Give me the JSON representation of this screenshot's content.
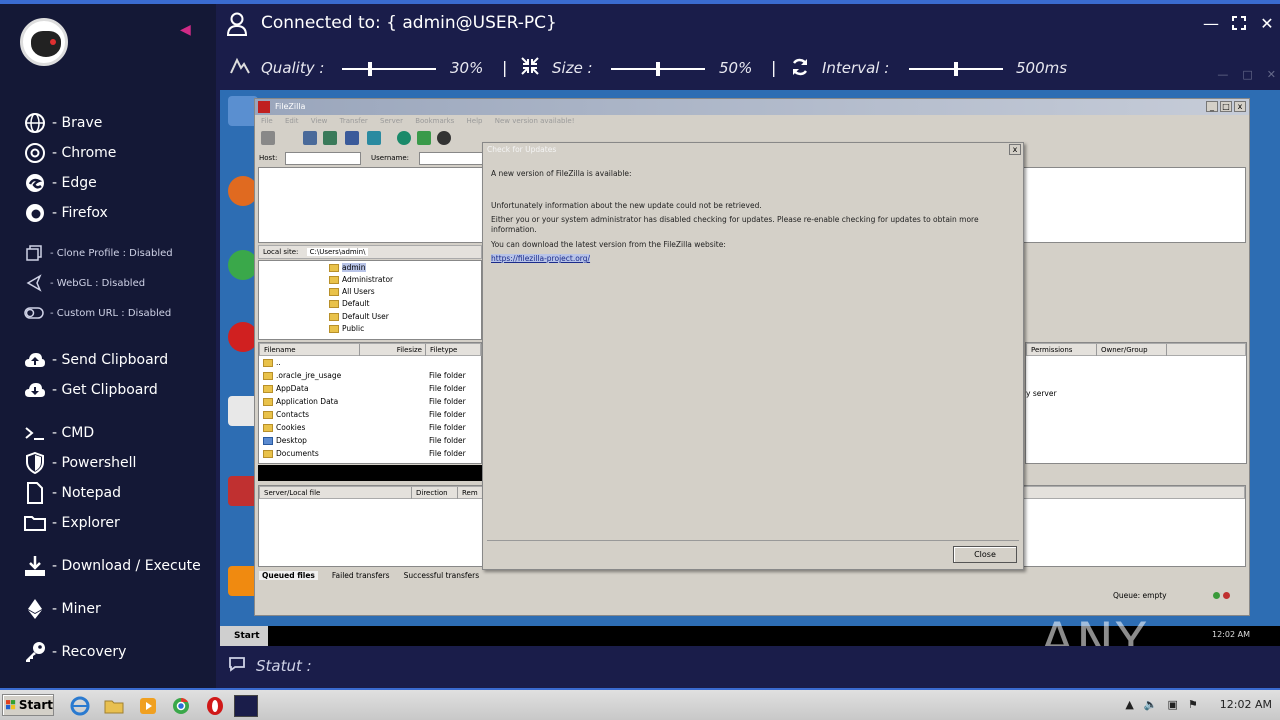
{
  "header": {
    "title": "Connected to: { admin@USER-PC}",
    "quality_label": "Quality :",
    "quality_value": "30%",
    "quality_level": 0.3,
    "size_label": "Size :",
    "size_value": "50%",
    "size_level": 0.5,
    "interval_label": "Interval :",
    "interval_value": "500ms",
    "interval_level": 0.5,
    "separator": "|"
  },
  "sidebar": {
    "browsers": [
      {
        "label": "- Brave",
        "icon": "globe-icon"
      },
      {
        "label": "- Chrome",
        "icon": "chrome-icon"
      },
      {
        "label": "- Edge",
        "icon": "edge-icon"
      },
      {
        "label": "- Firefox",
        "icon": "firefox-icon"
      }
    ],
    "settings": [
      {
        "label": "- Clone Profile : Disabled",
        "icon": "copy-icon"
      },
      {
        "label": "- WebGL : Disabled",
        "icon": "webgl-icon"
      },
      {
        "label": "- Custom URL : Disabled",
        "icon": "toggle-icon"
      }
    ],
    "clipboard": [
      {
        "label": "- Send Clipboard",
        "icon": "cloud-upload-icon"
      },
      {
        "label": "- Get Clipboard",
        "icon": "cloud-download-icon"
      }
    ],
    "tools": [
      {
        "label": "- CMD",
        "icon": "terminal-icon"
      },
      {
        "label": "- Powershell",
        "icon": "shield-icon"
      },
      {
        "label": "- Notepad",
        "icon": "file-icon"
      },
      {
        "label": "- Explorer",
        "icon": "folder-icon"
      }
    ],
    "download": {
      "label": "- Download / Execute",
      "icon": "download-icon"
    },
    "miner": {
      "label": "- Miner",
      "icon": "ethereum-icon"
    },
    "recovery": {
      "label": "- Recovery",
      "icon": "key-icon"
    }
  },
  "remote": {
    "filezilla": {
      "title": "FileZilla",
      "menu": [
        "File",
        "Edit",
        "View",
        "Transfer",
        "Server",
        "Bookmarks",
        "Help",
        "New version available!"
      ],
      "quickconnect": {
        "host_label": "Host:",
        "username_label": "Username:"
      },
      "local_site_label": "Local site:",
      "local_site_value": "C:\\Users\\admin\\",
      "tree": [
        "admin",
        "Administrator",
        "All Users",
        "Default",
        "Default User",
        "Public"
      ],
      "columns": {
        "filename": "Filename",
        "filesize": "Filesize",
        "filetype": "Filetype",
        "permissions": "Permissions",
        "owner": "Owner/Group"
      },
      "files": [
        {
          "name": "..",
          "type": ""
        },
        {
          "name": ".oracle_jre_usage",
          "type": "File folder"
        },
        {
          "name": "AppData",
          "type": "File folder"
        },
        {
          "name": "Application Data",
          "type": "File folder"
        },
        {
          "name": "Contacts",
          "type": "File folder"
        },
        {
          "name": "Cookies",
          "type": "File folder"
        },
        {
          "name": "Desktop",
          "type": "File folder"
        },
        {
          "name": "Documents",
          "type": "File folder"
        }
      ],
      "remote_status": "y server",
      "queue_columns": {
        "server_file": "Server/Local file",
        "direction": "Direction",
        "remote": "Rem"
      },
      "tabs": [
        "Queued files",
        "Failed transfers",
        "Successful transfers"
      ],
      "queue_status": "Queue: empty"
    },
    "dialog": {
      "title": "Check for Updates",
      "line1": "A new version of FileZilla is available:",
      "line2": "Unfortunately information about the new update could not be retrieved.",
      "line3": "Either you or your system administrator has disabled checking for updates. Please re-enable checking for updates to obtain more information.",
      "line4": "You can download the latest version from the FileZilla website:",
      "link": "https://filezilla-project.org/",
      "close": "Close"
    },
    "taskbar": {
      "start": "Start",
      "clock": "12:02 AM"
    },
    "watermark": "ANY RUN"
  },
  "status": {
    "label": "Statut :"
  },
  "host_taskbar": {
    "start": "Start",
    "clock": "12:02 AM"
  }
}
